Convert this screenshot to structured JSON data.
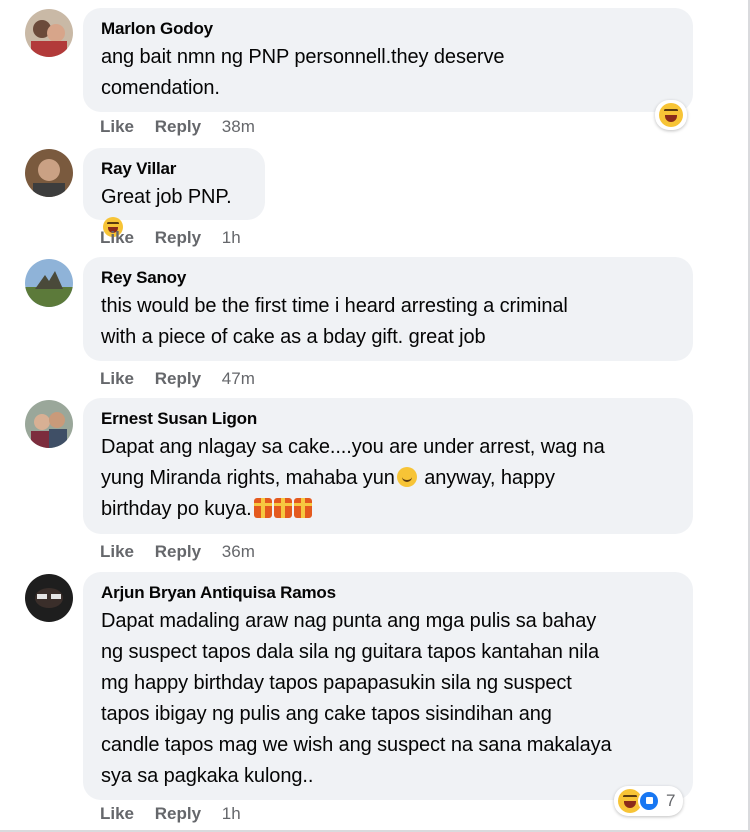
{
  "actions": {
    "like_label": "Like",
    "reply_label": "Reply"
  },
  "comments": [
    {
      "author": "Marlon Godoy",
      "lines": [
        "ang bait nmn ng PNP personnell.they deserve",
        "comendation."
      ],
      "time": "38m",
      "reaction_icons": [
        "laugh-emoji-icon"
      ]
    },
    {
      "author": "Ray Villar",
      "lines": [
        "Great job PNP. "
      ],
      "time": "1h",
      "inline_icons": [
        "laugh-emoji-icon"
      ]
    },
    {
      "author": "Rey Sanoy",
      "lines": [
        "this would be the first time i heard arresting a criminal",
        "with a piece of cake as a bday gift. great job"
      ],
      "time": "47m"
    },
    {
      "author": "Ernest Susan Ligon",
      "lines": [
        "Dapat ang nlagay sa cake....you are under arrest, wag na",
        "yung Miranda rights, mahaba yun",
        " anyway, happy",
        "birthday po kuya."
      ],
      "time": "36m",
      "inline_icons": [
        "smile-emoji-icon",
        "gift-icon"
      ]
    },
    {
      "author": "Arjun Bryan Antiquisa Ramos",
      "lines": [
        "Dapat madaling araw nag punta ang mga pulis sa bahay",
        "ng suspect tapos dala sila ng guitara tapos kantahan nila",
        "mg happy birthday tapos papapasukin sila ng suspect",
        "tapos ibigay ng pulis ang cake tapos sisindihan ang",
        "candle tapos mag we wish ang suspect na sana makalaya",
        "sya sa pagkaka kulong.."
      ],
      "time": "1h",
      "reaction_icons": [
        "laugh-emoji-icon",
        "like-icon"
      ],
      "reaction_count": "7"
    }
  ]
}
